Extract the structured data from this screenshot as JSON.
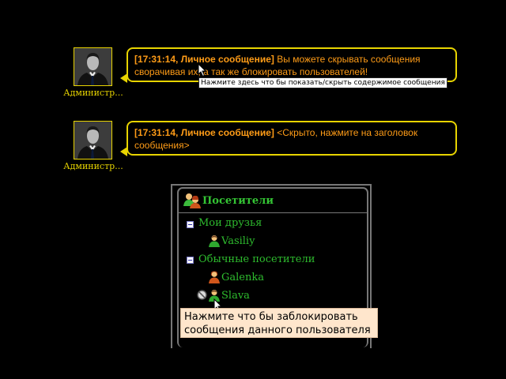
{
  "messages": [
    {
      "author": "Администр...",
      "header": "[17:31:14, Личное сообщение]",
      "text_line1": " Вы можете скрывать сообщения",
      "text_line2": "сворачивая их, а так же блокировать пользователей!"
    },
    {
      "author": "Администр...",
      "header": "[17:31:14, Личное сообщение]",
      "text_line1": " <Скрыто, нажмите на заголовок",
      "text_line2": "сообщения>"
    }
  ],
  "message_hint": "Нажмите здесь что бы показать/скрыть содержимое сообщения",
  "visitors": {
    "title": "Посетители",
    "groups": [
      {
        "label": "Мои друзья",
        "users": [
          "Vasiliy"
        ]
      },
      {
        "label": "Обычные посетители",
        "users": [
          "Galenka",
          "Slava"
        ]
      }
    ],
    "block_tooltip_line1": "Нажмите что бы заблокировать",
    "block_tooltip_line2": "сообщения данного пользователя"
  },
  "colors": {
    "background": "#000000",
    "bubble_border": "#e8d400",
    "message_text": "#ff9c17",
    "tree_text": "#2ebc2e",
    "tooltip_bg": "#ffe6cc"
  },
  "icons": [
    "user-avatar-icon",
    "male-user-icon",
    "female-user-icon",
    "collapse-icon",
    "block-icon",
    "mouse-cursor-icon"
  ]
}
